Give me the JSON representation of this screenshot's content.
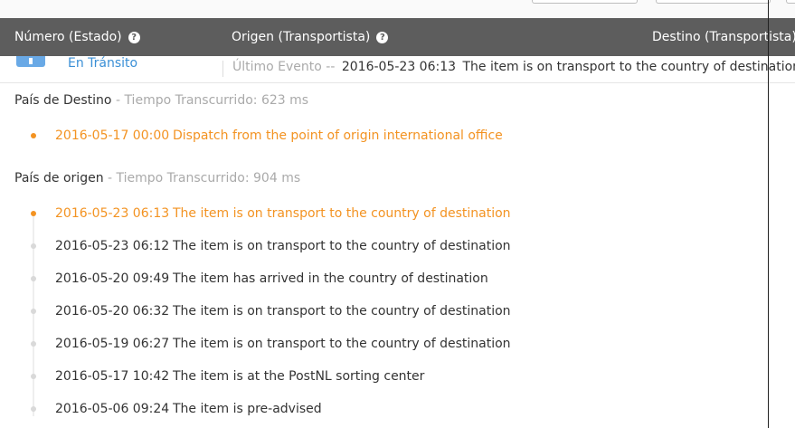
{
  "header": {
    "col_number": "Número (Estado)",
    "col_origin": "Origen (Transportista)",
    "col_destination": "Destino (Transportista)"
  },
  "summary": {
    "status": "En Tránsito",
    "last_event_label": "Último Evento --",
    "last_event_date": "2016-05-23 06:13",
    "last_event_desc": "The item is on transport to the country of destination"
  },
  "destination_section": {
    "title": "País de Destino",
    "meta": "- Tiempo Transcurrido: 623 ms",
    "events": [
      {
        "date": "2016-05-17 00:00",
        "desc": "Dispatch from the point of origin international office"
      }
    ]
  },
  "origin_section": {
    "title": "País de origen",
    "meta": "- Tiempo Transcurrido: 904 ms",
    "events": [
      {
        "date": "2016-05-23 06:13",
        "desc": "The item is on transport to the country of destination"
      },
      {
        "date": "2016-05-23 06:12",
        "desc": "The item is on transport to the country of destination"
      },
      {
        "date": "2016-05-20 09:49",
        "desc": "The item has arrived in the country of destination"
      },
      {
        "date": "2016-05-20 06:32",
        "desc": "The item is on transport to the country of destination"
      },
      {
        "date": "2016-05-19 06:27",
        "desc": "The item is on transport to the country of destination"
      },
      {
        "date": "2016-05-17 10:42",
        "desc": "The item is at the PostNL sorting center"
      },
      {
        "date": "2016-05-06 09:24",
        "desc": "The item is pre-advised"
      }
    ]
  },
  "colors": {
    "header_bg": "#5d5d5d",
    "accent_orange": "#f39322",
    "link_blue": "#3a8fd6",
    "muted": "#aaaaaa"
  },
  "icons": [
    "help-icon",
    "carrier-logo-icon",
    "timeline-dot-icon"
  ]
}
